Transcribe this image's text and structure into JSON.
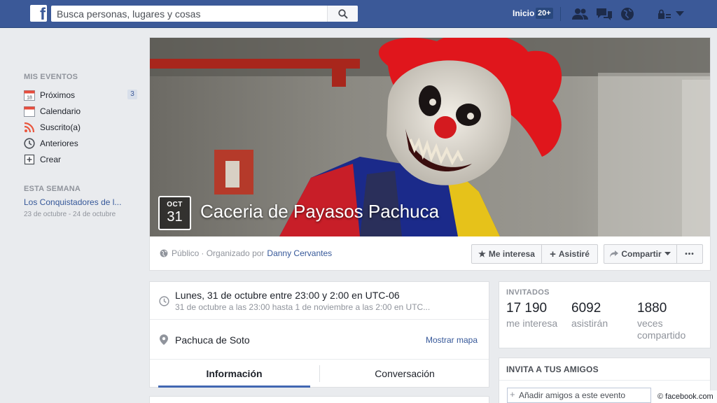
{
  "topbar": {
    "logo_letter": "f",
    "search_placeholder": "Busca personas, lugares y cosas",
    "home_label": "Inicio",
    "home_count": "20+"
  },
  "sidebar": {
    "heading_events": "MIS EVENTOS",
    "items": [
      {
        "label": "Próximos",
        "icon": "calendar-18-icon",
        "badge": "3"
      },
      {
        "label": "Calendario",
        "icon": "calendar-icon"
      },
      {
        "label": "Suscrito(a)",
        "icon": "rss-icon"
      },
      {
        "label": "Anteriores",
        "icon": "clock-icon"
      },
      {
        "label": "Crear",
        "icon": "plus-box-icon"
      }
    ],
    "heading_week": "ESTA SEMANA",
    "week_event": "Los Conquistadores de l...",
    "week_dates": "23 de octubre - 24 de octubre"
  },
  "event": {
    "month": "OCT",
    "day": "31",
    "title": "Caceria de Payasos Pachuca",
    "privacy": "Público",
    "organized_by": "· Organizado por",
    "organizer": "Danny Cervantes",
    "actions": {
      "interested": "Me interesa",
      "going": "Asistiré",
      "share": "Compartir",
      "more": "•••"
    }
  },
  "details": {
    "date_main": "Lunes, 31 de octubre entre 23:00 y 2:00 en UTC-06",
    "date_sub": "31 de octubre a las 23:00 hasta 1 de noviembre a las 2:00 en UTC...",
    "location": "Pachuca de Soto",
    "map_link": "Mostrar mapa",
    "tabs": [
      "Información",
      "Conversación"
    ]
  },
  "invited": {
    "heading": "INVITADOS",
    "stats": [
      {
        "number": "17 190",
        "label": "me interesa"
      },
      {
        "number": "6092",
        "label": "asistirán"
      },
      {
        "number": "1880",
        "label": "veces compartido"
      }
    ]
  },
  "invite": {
    "heading": "INVITA A TUS AMIGOS",
    "placeholder": "Añadir amigos a este evento"
  },
  "watermark": "© facebook.com",
  "colors": {
    "brand": "#3b5998",
    "link": "#365899",
    "muted": "#90949c",
    "background": "#e9ebee"
  }
}
